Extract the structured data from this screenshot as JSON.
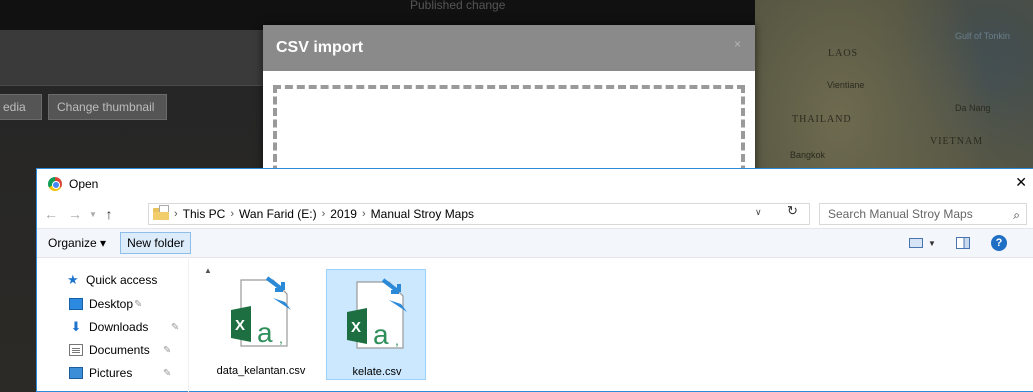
{
  "background": {
    "topbar_text": "Published change",
    "buttons": [
      "edia",
      "Change thumbnail"
    ],
    "map_labels": {
      "gulf": "Gulf of Tonkin",
      "laos": "LAOS",
      "vientiane": "Vientiane",
      "thailand": "THAILAND",
      "da_nang": "Da Nang",
      "vietnam": "VIETNAM",
      "bangkok": "Bangkok"
    }
  },
  "csv_modal": {
    "title": "CSV import",
    "close": "×"
  },
  "open_dialog": {
    "title": "Open",
    "close": "✕",
    "breadcrumb": [
      "This PC",
      "Wan Farid (E:)",
      "2019",
      "Manual Stroy Maps"
    ],
    "search_placeholder": "Search Manual Stroy Maps",
    "toolbar": {
      "organize": "Organize ▾",
      "new_folder": "New folder"
    },
    "nav": [
      {
        "label": "Quick access",
        "icon": "star-icon"
      },
      {
        "label": "Desktop",
        "icon": "desktop-icon"
      },
      {
        "label": "Downloads",
        "icon": "downloads-icon"
      },
      {
        "label": "Documents",
        "icon": "documents-icon"
      },
      {
        "label": "Pictures",
        "icon": "pictures-icon"
      }
    ],
    "files": [
      {
        "name": "data_kelantan.csv",
        "selected": false
      },
      {
        "name": "kelate.csv",
        "selected": true
      }
    ]
  }
}
